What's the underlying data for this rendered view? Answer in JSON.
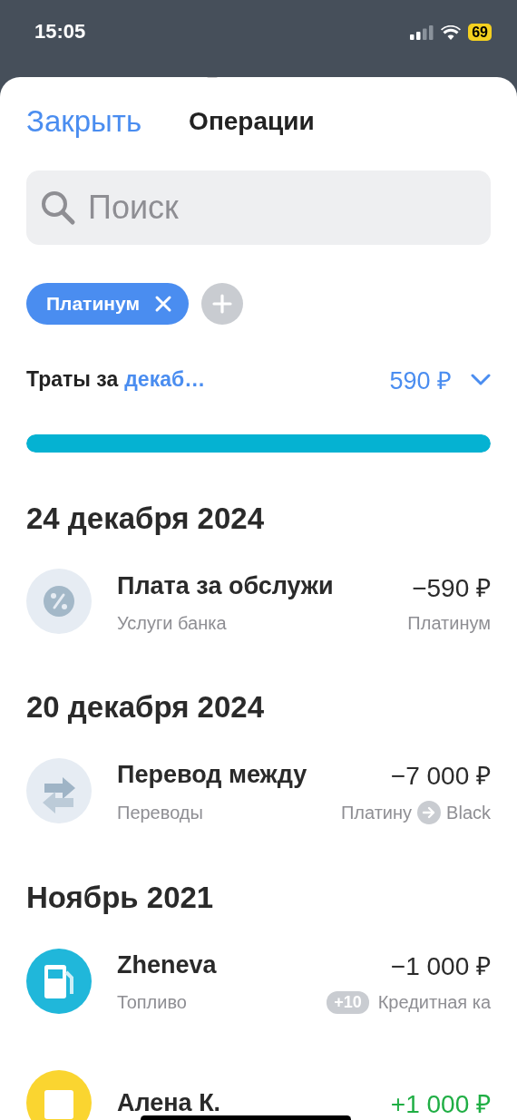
{
  "status_bar": {
    "time": "15:05",
    "battery": "69"
  },
  "header": {
    "close": "Закрыть",
    "title": "Операции"
  },
  "search": {
    "placeholder": "Поиск"
  },
  "filters": [
    {
      "label": "Платинум"
    }
  ],
  "spending": {
    "label": "Траты за",
    "period": "декаб…",
    "amount": "590 ₽",
    "level": 1
  },
  "sections": [
    {
      "heading": "24 декабря 2024",
      "items": [
        {
          "kind": "percent",
          "title": "Плата за обслужи",
          "category": "Услуги банка",
          "amount": "−590 ₽",
          "income": false,
          "account": "Платинум"
        }
      ]
    },
    {
      "heading": "20 декабря 2024",
      "items": [
        {
          "kind": "transfer",
          "title": "Перевод между",
          "category": "Переводы",
          "amount": "−7 000 ₽",
          "income": false,
          "account": "Платину",
          "to_account": "Black"
        }
      ]
    },
    {
      "heading": "Ноябрь 2021",
      "items": [
        {
          "kind": "fuel",
          "title": "Zheneva",
          "category": "Топливо",
          "amount": "−1 000 ₽",
          "income": false,
          "bonus": "+10",
          "account": "Кредитная ка"
        },
        {
          "kind": "letter",
          "title": "Алена К.",
          "amount": "+1 000 ₽",
          "income": true
        }
      ]
    }
  ]
}
